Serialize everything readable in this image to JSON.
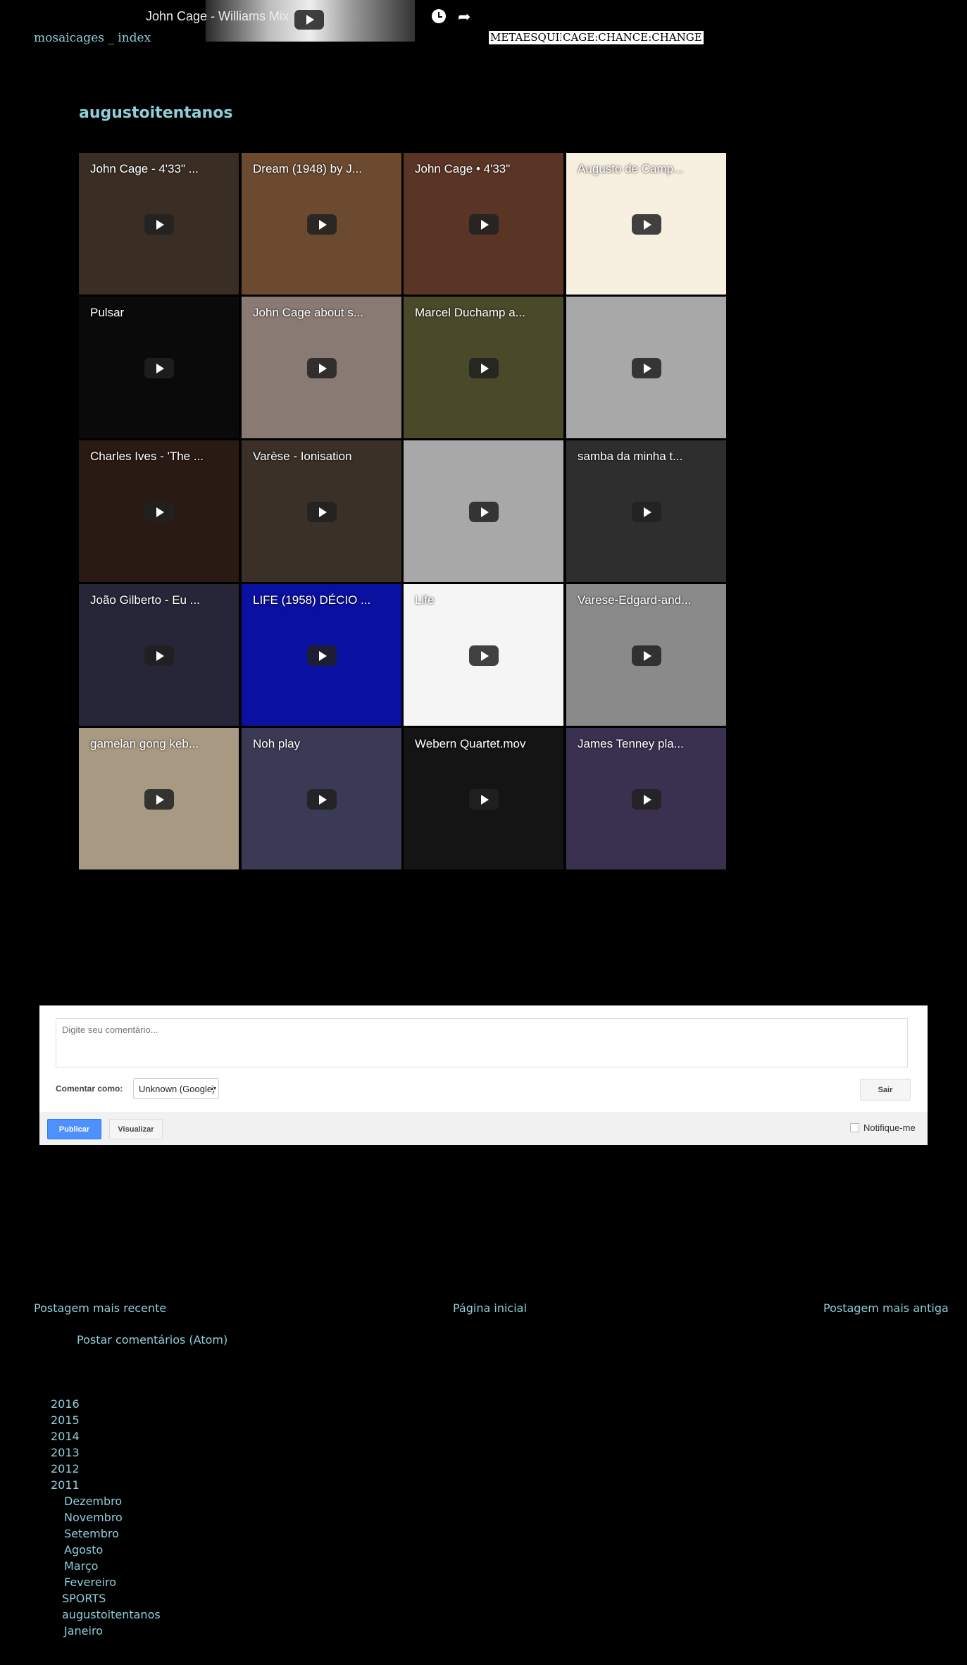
{
  "header": {
    "home_link": "mosaicages _ index",
    "top_video_title": "John Cage - Williams Mix",
    "tags": [
      "METAESQUINA",
      "CAGE:CHANCE:CHANGE"
    ],
    "icons": [
      "watch-later-icon",
      "share-icon"
    ]
  },
  "section_title": "augustoitentanos",
  "videos": [
    {
      "title": "John Cage - 4'33\" ...",
      "bg": "#3a2e24"
    },
    {
      "title": "Dream (1948) by J...",
      "bg": "#6b4a30"
    },
    {
      "title": "John Cage • 4'33\"",
      "bg": "#5a3526"
    },
    {
      "title": "Augusto de Camp...",
      "bg": "#f7efe0"
    },
    {
      "title": "Pulsar",
      "bg": "#0a0a0a"
    },
    {
      "title": "John Cage about s...",
      "bg": "#8a7a74"
    },
    {
      "title": "Marcel Duchamp a...",
      "bg": "#4a4a2a"
    },
    {
      "title": "",
      "bg": "#a8a8a8"
    },
    {
      "title": "Charles Ives - 'The ...",
      "bg": "#2a1a14"
    },
    {
      "title": "Varèse - Ionisation",
      "bg": "#3a3028"
    },
    {
      "title": "",
      "bg": "#a8a8a8"
    },
    {
      "title": "samba da minha t...",
      "bg": "#2e2e2e"
    },
    {
      "title": "João Gilberto - Eu ...",
      "bg": "#262638"
    },
    {
      "title": "LIFE (1958) DÉCIO ...",
      "bg": "#0a10a0"
    },
    {
      "title": "Life",
      "bg": "#f5f5f5"
    },
    {
      "title": "Varese-Edgard-and...",
      "bg": "#8a8a8a"
    },
    {
      "title": "gamelan gong keb...",
      "bg": "#a89a82"
    },
    {
      "title": "Noh play",
      "bg": "#3a3a55"
    },
    {
      "title": "Webern Quartet.mov",
      "bg": "#141414"
    },
    {
      "title": "James Tenney pla...",
      "bg": "#3a3050"
    }
  ],
  "comment_form": {
    "placeholder": "Digite seu comentário...",
    "comment_as_label": "Comentar como:",
    "comment_as_value": "Unknown (Google)",
    "signout_label": "Sair",
    "publish_label": "Publicar",
    "preview_label": "Visualizar",
    "notify_label": "Notifique-me"
  },
  "pager": {
    "newer": "Postagem mais recente",
    "home": "Página inicial",
    "older": "Postagem mais antiga",
    "atom": "Postar comentários (Atom)"
  },
  "archive": {
    "years": [
      "2016",
      "2015",
      "2014",
      "2013",
      "2012",
      "2011"
    ],
    "months_2011": [
      "Dezembro",
      "Novembro",
      "Setembro",
      "Agosto",
      "Março",
      "Fevereiro"
    ],
    "posts": [
      "SPORTS",
      "augustoitentanos"
    ],
    "last_month": "Janeiro"
  },
  "colors": {
    "link": "#8fcfd9",
    "background": "#000000",
    "publish": "#4d90fe"
  }
}
